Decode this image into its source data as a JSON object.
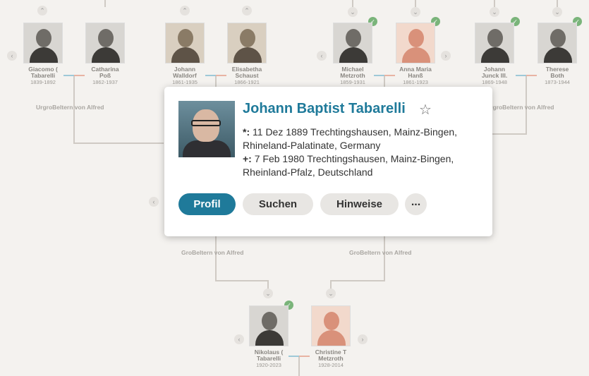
{
  "tree": {
    "relation_labels": {
      "great_grandparents_left": "UrgroBeltern von Alfred",
      "great_grandparents_right": "UrgroBeltern von Alfred",
      "grandparents_left": "GroBeltern von Alfred",
      "grandparents_right": "GroBeltern von Alfred"
    },
    "people": [
      {
        "name_line1": "Giacomo (",
        "name_line2": "Tabarelli",
        "dates": "1839-1892"
      },
      {
        "name_line1": "Catharina",
        "name_line2": "Poß",
        "dates": "1862-1937"
      },
      {
        "name_line1": "Johann",
        "name_line2": "Walldorf",
        "dates": "1861-1935"
      },
      {
        "name_line1": "Elisabetha",
        "name_line2": "Schaust",
        "dates": "1866-1921"
      },
      {
        "name_line1": "Michael",
        "name_line2": "Metzroth",
        "dates": "1859-1931"
      },
      {
        "name_line1": "Anna Maria",
        "name_line2": "Hanß",
        "dates": "1861-1923"
      },
      {
        "name_line1": "Johann",
        "name_line2": "Junck III.",
        "dates": "1869-1948"
      },
      {
        "name_line1": "Therese",
        "name_line2": "Both",
        "dates": "1873-1944"
      },
      {
        "name_line1": "Nikolaus (",
        "name_line2": "Tabarelli",
        "dates": "1920-2023"
      },
      {
        "name_line1": "Christine T",
        "name_line2": "Metzroth",
        "dates": "1928-2014"
      }
    ]
  },
  "popup": {
    "name": "Johann Baptist Tabarelli",
    "birth_marker": "*:",
    "birth": "11 Dez 1889 Trechtingshausen, Mainz-Bingen, Rhineland-Palatinate, Germany",
    "death_marker": "+:",
    "death": "7 Feb 1980 Trechtingshausen, Mainz-Bingen, Rheinland-Pfalz, Deutschland",
    "buttons": {
      "profile": "Profil",
      "search": "Suchen",
      "hints": "Hinweise",
      "more": "..."
    }
  },
  "colors": {
    "accent": "#1f7a9a",
    "hint_badge": "#7ab47a",
    "background": "#f4f2ef"
  }
}
